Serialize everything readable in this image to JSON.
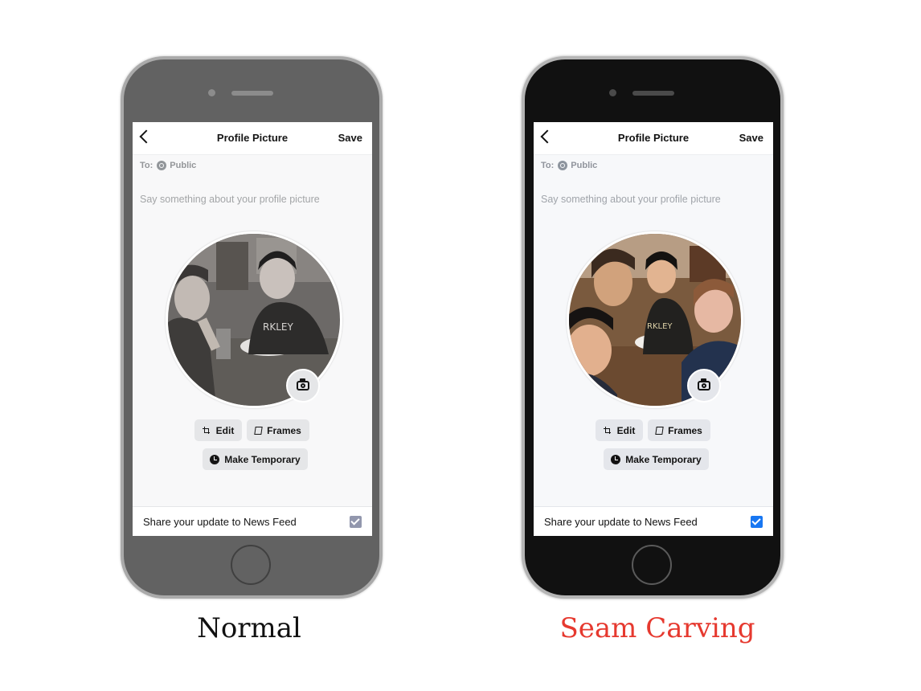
{
  "panels": [
    {
      "id": "normal",
      "nav": {
        "title": "Profile Picture",
        "save_label": "Save"
      },
      "audience": {
        "prefix": "To:",
        "value": "Public"
      },
      "caption_placeholder": "Say something about your profile picture",
      "buttons": {
        "edit": "Edit",
        "frames": "Frames",
        "temporary": "Make Temporary"
      },
      "share": {
        "label": "Share your update to News Feed",
        "checked": true
      },
      "label": "Normal"
    },
    {
      "id": "seam-carving",
      "nav": {
        "title": "Profile Picture",
        "save_label": "Save"
      },
      "audience": {
        "prefix": "To:",
        "value": "Public"
      },
      "caption_placeholder": "Say something about your profile picture",
      "buttons": {
        "edit": "Edit",
        "frames": "Frames",
        "temporary": "Make Temporary"
      },
      "share": {
        "label": "Share your update to News Feed",
        "checked": true
      },
      "label": "Seam Carving"
    }
  ],
  "colors": {
    "accent": "#1877f2",
    "right_label": "#e6392f",
    "left_phone": "#5f5f5f",
    "right_phone": "#111111"
  },
  "icons": [
    "back-icon",
    "globe-icon",
    "camera-icon",
    "crop-icon",
    "frame-icon",
    "clock-icon",
    "checkbox-icon"
  ]
}
